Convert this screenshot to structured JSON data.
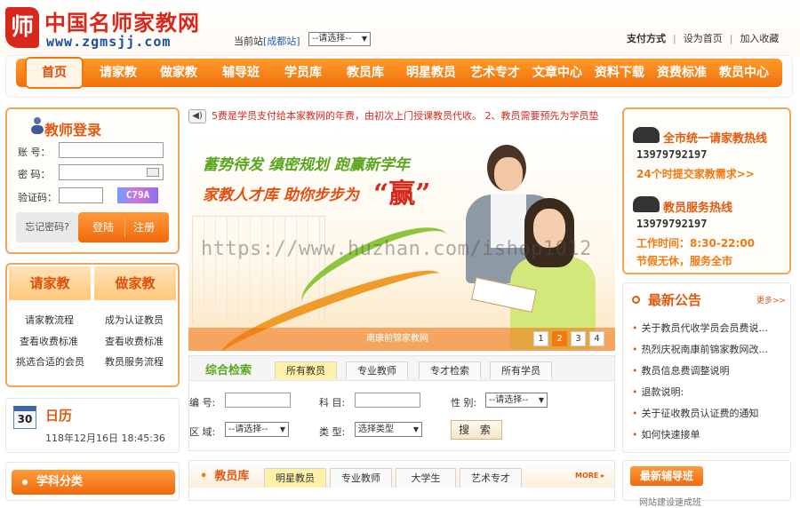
{
  "header": {
    "logo_mark": "师",
    "logo_cn": "中国名师家教网",
    "logo_url": "www.zgmsjj.com",
    "station_label": "当前站",
    "station_city": "[成都站]",
    "city_select": "--请选择--",
    "links": [
      "支付方式",
      "设为首页",
      "加入收藏"
    ]
  },
  "nav": {
    "items": [
      "首页",
      "请家教",
      "做家教",
      "辅导班",
      "学员库",
      "教员库",
      "明星教员",
      "艺术专才",
      "文章中心",
      "资料下载",
      "资费标准",
      "教员中心"
    ]
  },
  "login": {
    "title": "教师登录",
    "account_label": "账 号：",
    "password_label": "密 码：",
    "captcha_label": "验证码：",
    "captcha_text": "C79A",
    "forgot": "忘记密码?",
    "login_btn": "登陆",
    "register_btn": "注册"
  },
  "qjj": {
    "left_title": "请家教",
    "right_title": "做家教",
    "left_items": [
      "请家教流程",
      "查看收费标准",
      "挑选合适的会员"
    ],
    "right_items": [
      "成为认证教员",
      "查看收费标准",
      "教员服务流程"
    ]
  },
  "calendar": {
    "icon_day": "30",
    "title": "日历",
    "datetime": "118年12月16日  18:45:36"
  },
  "subject": {
    "title": "学科分类"
  },
  "notice": {
    "text": "5费是学员支付给本家教网的年费，由初次上门授课教员代收。 2、教员需要预先为学员垫"
  },
  "banner": {
    "line1": "蓄势待发  缜密规划  跑赢新学年",
    "line2": "家教人才库  助你步步为",
    "win": "“赢”",
    "caption": "南康前锦家教网",
    "pages": [
      "1",
      "2",
      "3",
      "4"
    ]
  },
  "search": {
    "title": "综合检索",
    "tabs": [
      "所有教员",
      "专业教师",
      "专才检索",
      "所有学员"
    ],
    "number_label": "编 号:",
    "subject_label": "科 目:",
    "gender_label": "性 别:",
    "gender_select": "--请选择--",
    "area_label": "区 域:",
    "area_select": "--请选择--",
    "type_label": "类 型:",
    "type_select": "选择类型",
    "search_btn": "搜 索"
  },
  "teachers": {
    "title": "教员库",
    "tabs": [
      "明星教员",
      "专业教师",
      "大学生",
      "艺术专才"
    ],
    "more": "MORE ▸"
  },
  "hotline": {
    "title1": "全市统一请家教热线",
    "number1": "13979792197",
    "link1": "24个时提交家教需求>>",
    "title2": "教员服务热线",
    "number2": "13979792197",
    "hours": "工作时间：8:30-22:00",
    "holiday": "节假无休，服务全市"
  },
  "news": {
    "title": "最新公告",
    "more": "更多>>",
    "items": [
      "关于教员代收学员会员费说...",
      "热烈庆祝南康前锦家教网改...",
      "教员信息费调整说明",
      "退款说明:",
      "关于征收教员认证费的通知",
      "如何快速接单"
    ]
  },
  "tutor": {
    "title": "最新辅导班",
    "sub": "网站建设速成班"
  },
  "watermark": "https://www.huzhan.com/ishop1012",
  "colors": {
    "accent": "#f07a10",
    "brand_red": "#d8281c",
    "green": "#5aa61e"
  }
}
